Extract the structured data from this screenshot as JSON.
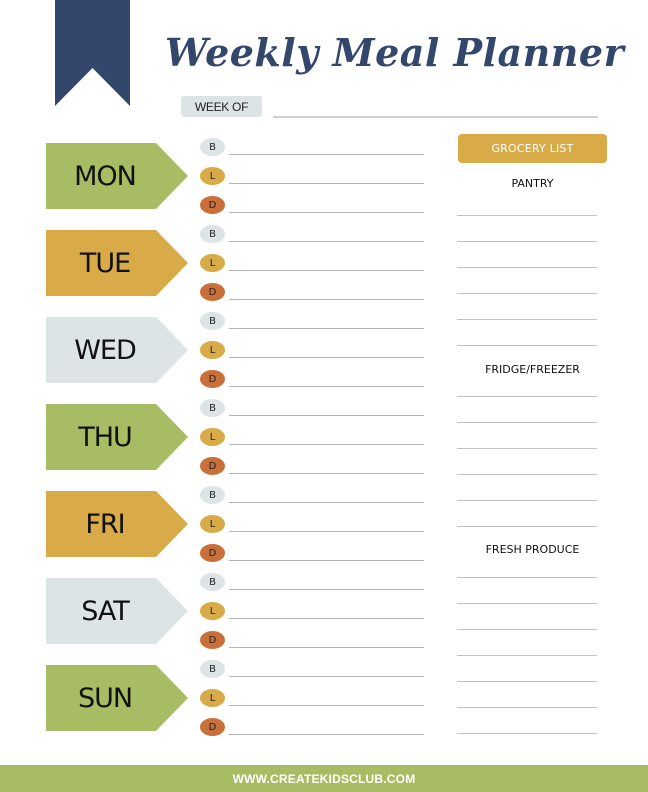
{
  "header": {
    "title": "Weekly Meal Planner",
    "week_of_label": "WEEK OF"
  },
  "colors": {
    "navy": "#33466c",
    "green": "#a8bd63",
    "mustard": "#d8ab48",
    "light_blue_gray": "#dde4e5",
    "rust": "#c9703a"
  },
  "days": [
    {
      "label": "MON",
      "color": "#a8bd63"
    },
    {
      "label": "TUE",
      "color": "#d8ab48"
    },
    {
      "label": "WED",
      "color": "#dde4e5"
    },
    {
      "label": "THU",
      "color": "#a8bd63"
    },
    {
      "label": "FRI",
      "color": "#d8ab48"
    },
    {
      "label": "SAT",
      "color": "#dde4e5"
    },
    {
      "label": "SUN",
      "color": "#a8bd63"
    }
  ],
  "meals": [
    {
      "label": "B",
      "name": "breakfast",
      "color": "#dde4e5"
    },
    {
      "label": "L",
      "name": "lunch",
      "color": "#d8ab48"
    },
    {
      "label": "D",
      "name": "dinner",
      "color": "#c9703a"
    }
  ],
  "grocery": {
    "button_label": "GROCERY LIST",
    "sections": [
      {
        "title": "PANTRY",
        "lines": 6
      },
      {
        "title": "FRIDGE/FREEZER",
        "lines": 6
      },
      {
        "title": "FRESH PRODUCE",
        "lines": 7
      }
    ]
  },
  "footer": {
    "url": "WWW.CREATEKIDSCLUB.COM"
  }
}
